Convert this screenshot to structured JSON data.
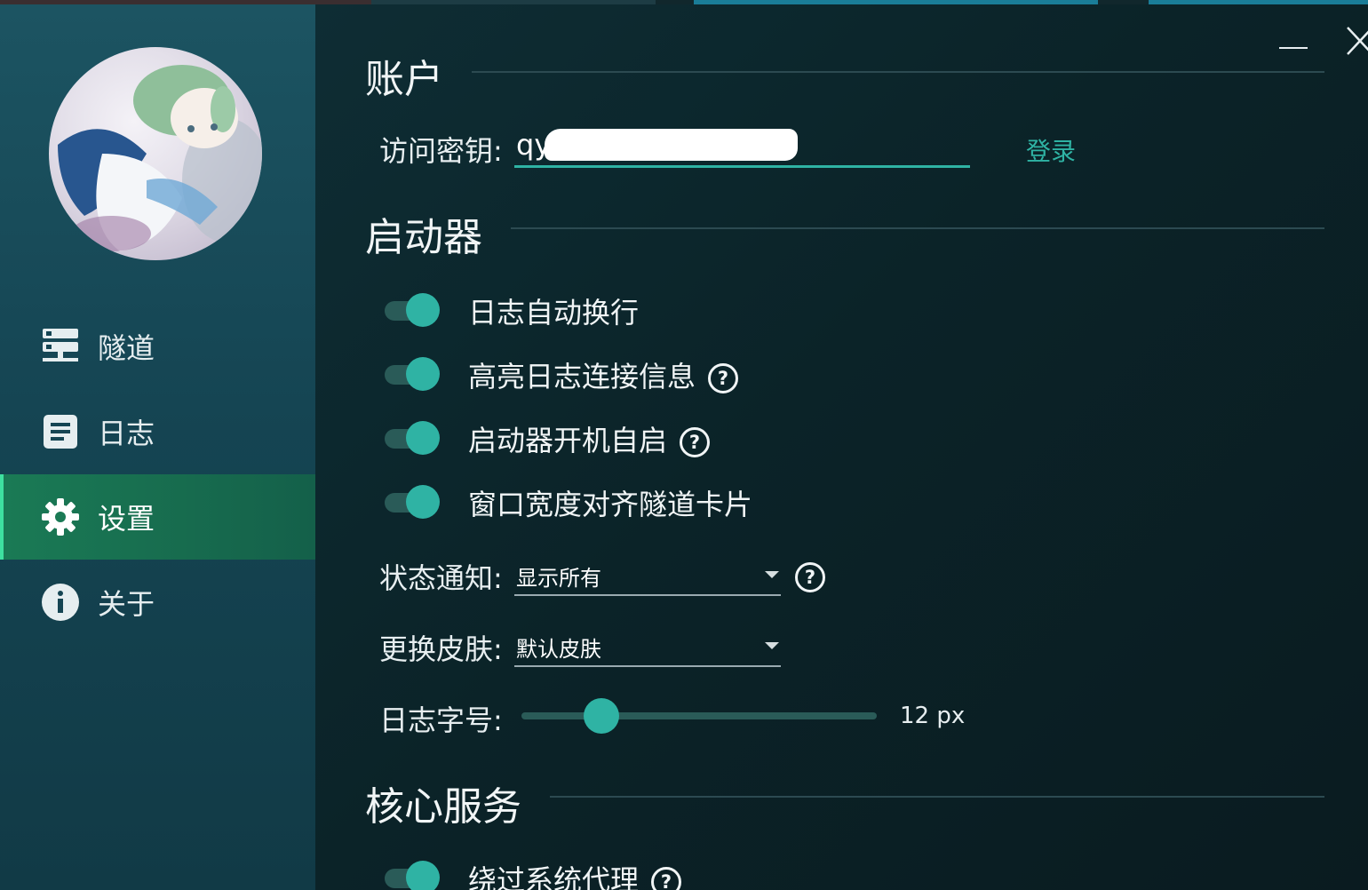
{
  "sidebar": {
    "items": [
      {
        "label": "隧道",
        "icon": "tunnel-server-icon",
        "active": false
      },
      {
        "label": "日志",
        "icon": "log-document-icon",
        "active": false
      },
      {
        "label": "设置",
        "icon": "gear-icon",
        "active": true
      },
      {
        "label": "关于",
        "icon": "info-icon",
        "active": false
      }
    ]
  },
  "account": {
    "title": "账户",
    "access_key_label": "访问密钥:",
    "access_key_value": "qy",
    "login_label": "登录"
  },
  "launcher": {
    "title": "启动器",
    "toggles": [
      {
        "label": "日志自动换行",
        "on": true,
        "help": false
      },
      {
        "label": "高亮日志连接信息",
        "on": true,
        "help": true
      },
      {
        "label": "启动器开机自启",
        "on": true,
        "help": true
      },
      {
        "label": "窗口宽度对齐隧道卡片",
        "on": true,
        "help": false
      }
    ],
    "notify_label": "状态通知:",
    "notify_value": "显示所有",
    "skin_label": "更换皮肤:",
    "skin_value": "默认皮肤",
    "font_size_label": "日志字号:",
    "font_size_value": "12 px",
    "font_size_fraction": 0.225
  },
  "core": {
    "title": "核心服务",
    "toggles": [
      {
        "label": "绕过系统代理",
        "on": true,
        "help": true
      }
    ]
  },
  "colors": {
    "accent": "#2fb3a4",
    "active_nav": "#1a7a55",
    "sidebar": "#1c5462",
    "background": "#0c2329"
  }
}
